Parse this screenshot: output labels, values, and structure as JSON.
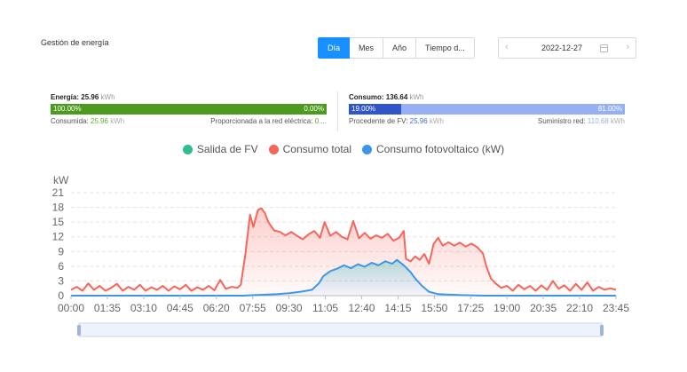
{
  "page": {
    "title": "Gestión de energía"
  },
  "period_tabs": [
    {
      "label": "Día",
      "active": true
    },
    {
      "label": "Mes",
      "active": false
    },
    {
      "label": "Año",
      "active": false
    },
    {
      "label": "Tiempo d...",
      "active": false
    }
  ],
  "date_picker": {
    "value": "2022-12-27",
    "prev_icon": "chevron-left-icon",
    "next_icon": "chevron-right-icon",
    "calendar_icon": "calendar-icon"
  },
  "energy": {
    "label": "Energía:",
    "value": "25.96",
    "unit": "kWh",
    "bar_left_pct": "100.00%",
    "bar_right_pct": "0.00%",
    "bar_left_fraction": 1.0,
    "consumed_label": "Consumida:",
    "consumed_value": "25.96",
    "consumed_unit": "kWh",
    "grid_label": "Proporcionada a la red eléctrica:",
    "grid_value": "0....",
    "colors": {
      "left": "#4e9a1e",
      "right": "#4e9a1e"
    }
  },
  "consumption": {
    "label": "Consumo:",
    "value": "136.64",
    "unit": "kWh",
    "bar_left_pct": "19.00%",
    "bar_right_pct": "81.00%",
    "bar_left_fraction": 0.19,
    "pv_label": "Procedente de FV:",
    "pv_value": "25.96",
    "pv_unit": "kWh",
    "supply_label": "Suministro red:",
    "supply_value": "110.68",
    "supply_unit": "kWh",
    "colors": {
      "left": "#2f55c8",
      "right": "#97b0f5"
    }
  },
  "legend": [
    {
      "label": "Salida de FV",
      "color": "#2ec08c"
    },
    {
      "label": "Consumo total",
      "color": "#f4665b"
    },
    {
      "label": "Consumo fotovoltaico (kW)",
      "color": "#3c97ea"
    }
  ],
  "chart_data": {
    "type": "line",
    "ylabel": "kW",
    "ylim": [
      0,
      21
    ],
    "yticks": [
      0,
      3,
      6,
      9,
      12,
      15,
      18,
      21
    ],
    "xlim_hours": [
      0,
      23.75
    ],
    "xtick_labels": [
      "00:00",
      "01:35",
      "03:10",
      "04:45",
      "06:20",
      "07:55",
      "09:30",
      "11:05",
      "12:40",
      "14:15",
      "15:50",
      "17:25",
      "19:00",
      "20:35",
      "22:10",
      "23:45"
    ],
    "grid": true,
    "series": [
      {
        "name": "Consumo total",
        "color": "#f4665b",
        "points": [
          [
            0.0,
            1.2
          ],
          [
            0.25,
            1.8
          ],
          [
            0.5,
            1.0
          ],
          [
            0.75,
            2.5
          ],
          [
            1.0,
            1.2
          ],
          [
            1.25,
            2.0
          ],
          [
            1.5,
            1.0
          ],
          [
            1.75,
            1.6
          ],
          [
            2.0,
            2.4
          ],
          [
            2.25,
            1.0
          ],
          [
            2.5,
            1.8
          ],
          [
            2.75,
            1.2
          ],
          [
            3.0,
            2.2
          ],
          [
            3.25,
            1.0
          ],
          [
            3.5,
            1.7
          ],
          [
            3.75,
            1.2
          ],
          [
            4.0,
            2.0
          ],
          [
            4.25,
            1.0
          ],
          [
            4.5,
            1.9
          ],
          [
            4.75,
            1.3
          ],
          [
            5.0,
            2.2
          ],
          [
            5.25,
            1.0
          ],
          [
            5.5,
            1.7
          ],
          [
            5.75,
            1.2
          ],
          [
            6.0,
            2.0
          ],
          [
            6.25,
            1.1
          ],
          [
            6.5,
            3.2
          ],
          [
            6.75,
            1.4
          ],
          [
            7.0,
            1.8
          ],
          [
            7.25,
            1.6
          ],
          [
            7.4,
            2.2
          ],
          [
            7.6,
            8.5
          ],
          [
            7.8,
            16.5
          ],
          [
            7.95,
            14.0
          ],
          [
            8.15,
            17.5
          ],
          [
            8.3,
            17.8
          ],
          [
            8.45,
            16.8
          ],
          [
            8.6,
            15.0
          ],
          [
            8.85,
            13.3
          ],
          [
            9.1,
            13.0
          ],
          [
            9.35,
            12.3
          ],
          [
            9.6,
            13.0
          ],
          [
            9.85,
            12.2
          ],
          [
            10.1,
            11.5
          ],
          [
            10.35,
            12.5
          ],
          [
            10.6,
            13.2
          ],
          [
            10.85,
            11.8
          ],
          [
            11.05,
            15.0
          ],
          [
            11.3,
            12.2
          ],
          [
            11.55,
            13.0
          ],
          [
            11.8,
            12.0
          ],
          [
            12.05,
            11.5
          ],
          [
            12.3,
            15.2
          ],
          [
            12.55,
            11.7
          ],
          [
            12.8,
            12.8
          ],
          [
            13.05,
            11.6
          ],
          [
            13.3,
            12.3
          ],
          [
            13.55,
            11.8
          ],
          [
            13.8,
            12.6
          ],
          [
            14.05,
            11.2
          ],
          [
            14.3,
            11.8
          ],
          [
            14.5,
            13.2
          ],
          [
            14.6,
            7.5
          ],
          [
            14.8,
            7.0
          ],
          [
            15.0,
            8.0
          ],
          [
            15.2,
            7.3
          ],
          [
            15.4,
            8.5
          ],
          [
            15.6,
            6.5
          ],
          [
            15.8,
            10.5
          ],
          [
            16.0,
            11.8
          ],
          [
            16.2,
            10.2
          ],
          [
            16.45,
            10.9
          ],
          [
            16.7,
            10.2
          ],
          [
            16.95,
            10.8
          ],
          [
            17.2,
            10.0
          ],
          [
            17.45,
            10.6
          ],
          [
            17.7,
            9.9
          ],
          [
            17.95,
            8.6
          ],
          [
            18.1,
            6.0
          ],
          [
            18.3,
            3.5
          ],
          [
            18.5,
            2.5
          ],
          [
            18.75,
            1.6
          ],
          [
            19.0,
            2.0
          ],
          [
            19.25,
            1.0
          ],
          [
            19.5,
            2.2
          ],
          [
            19.75,
            1.3
          ],
          [
            20.0,
            2.0
          ],
          [
            20.25,
            1.0
          ],
          [
            20.5,
            2.1
          ],
          [
            20.75,
            1.2
          ],
          [
            21.0,
            3.0
          ],
          [
            21.25,
            1.4
          ],
          [
            21.5,
            2.1
          ],
          [
            21.75,
            1.0
          ],
          [
            22.0,
            2.4
          ],
          [
            22.25,
            1.2
          ],
          [
            22.5,
            2.7
          ],
          [
            22.75,
            1.0
          ],
          [
            23.0,
            1.8
          ],
          [
            23.25,
            1.2
          ],
          [
            23.5,
            1.5
          ],
          [
            23.75,
            1.2
          ]
        ]
      },
      {
        "name": "Consumo fotovoltaico (kW)",
        "color": "#3c97ea",
        "points": [
          [
            0.0,
            0.0
          ],
          [
            7.5,
            0.0
          ],
          [
            8.0,
            0.1
          ],
          [
            8.5,
            0.2
          ],
          [
            9.0,
            0.3
          ],
          [
            9.5,
            0.5
          ],
          [
            10.0,
            0.8
          ],
          [
            10.5,
            1.2
          ],
          [
            10.8,
            2.5
          ],
          [
            11.0,
            4.0
          ],
          [
            11.3,
            5.0
          ],
          [
            11.6,
            5.5
          ],
          [
            11.9,
            6.2
          ],
          [
            12.2,
            5.6
          ],
          [
            12.5,
            6.4
          ],
          [
            12.8,
            5.9
          ],
          [
            13.1,
            6.7
          ],
          [
            13.4,
            6.2
          ],
          [
            13.7,
            7.0
          ],
          [
            14.0,
            6.5
          ],
          [
            14.2,
            7.3
          ],
          [
            14.5,
            6.2
          ],
          [
            14.8,
            4.8
          ],
          [
            15.0,
            3.5
          ],
          [
            15.3,
            2.0
          ],
          [
            15.6,
            0.8
          ],
          [
            16.0,
            0.3
          ],
          [
            17.0,
            0.1
          ],
          [
            18.0,
            0.0
          ],
          [
            23.75,
            0.0
          ]
        ]
      }
    ]
  },
  "zoom_slider": {
    "range": [
      0,
      100
    ]
  }
}
